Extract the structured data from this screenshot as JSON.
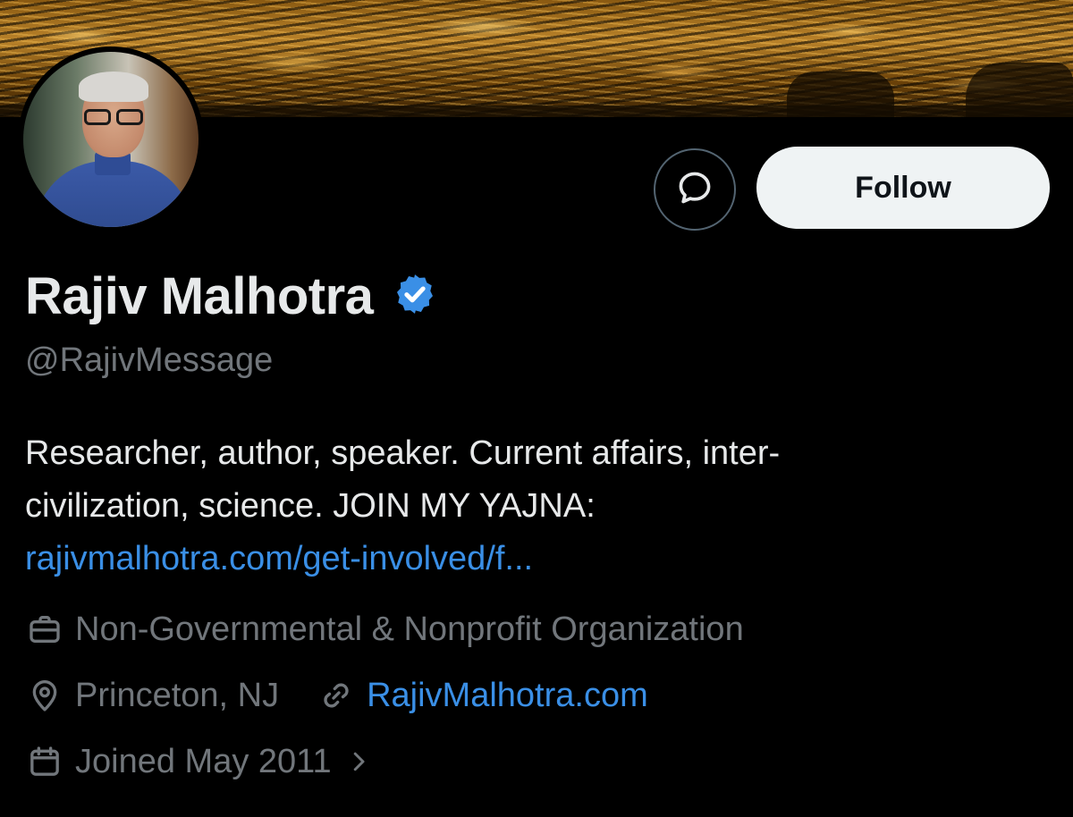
{
  "profile": {
    "display_name": "Rajiv Malhotra",
    "handle": "@RajivMessage",
    "verified_icon": "verified-badge-icon",
    "bio_line1": "Researcher, author, speaker. Current affairs, inter-",
    "bio_line2": "civilization, science. JOIN MY YAJNA:",
    "bio_link": "rajivmalhotra.com/get-involved/f...",
    "category": "Non-Governmental & Nonprofit Organization",
    "location": "Princeton, NJ",
    "website": "RajivMalhotra.com",
    "joined": "Joined May 2011"
  },
  "actions": {
    "follow_label": "Follow",
    "message_icon": "message-bubble-icon"
  },
  "icons": {
    "category": "briefcase-icon",
    "location": "location-pin-icon",
    "website": "link-icon",
    "joined": "calendar-icon",
    "joined_more": "chevron-right-icon"
  },
  "colors": {
    "background": "#000000",
    "text_primary": "#e7e9ea",
    "text_secondary": "#71767b",
    "link": "#3a8fe6",
    "verified": "#3a8fe6",
    "follow_bg": "#eff3f4"
  }
}
